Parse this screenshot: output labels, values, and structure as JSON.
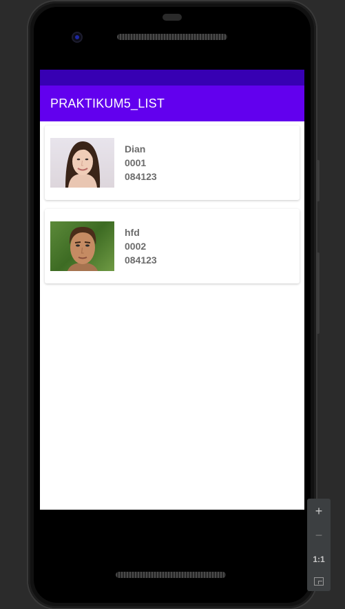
{
  "app": {
    "title": "PRAKTIKUM5_LIST",
    "colors": {
      "primary": "#6200ee",
      "primary_dark": "#3700b3"
    }
  },
  "list": {
    "items": [
      {
        "name": "Dian",
        "id": "0001",
        "code": "084123",
        "image": "woman-portrait"
      },
      {
        "name": "hfd",
        "id": "0002",
        "code": "084123",
        "image": "man-portrait"
      }
    ]
  },
  "emulator": {
    "zoom_in": "+",
    "zoom_out": "−",
    "zoom_actual": "1:1",
    "zoom_fit_icon": "fit-screen-icon"
  }
}
